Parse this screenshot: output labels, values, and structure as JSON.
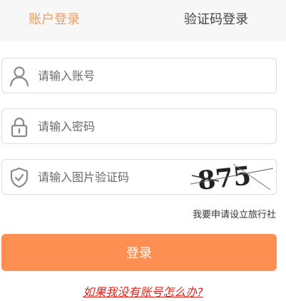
{
  "tabs": {
    "account_login": "账户登录",
    "code_login": "验证码登录"
  },
  "form": {
    "username_placeholder": "请输入账号",
    "password_placeholder": "请输入密码",
    "captcha_placeholder": "请输入图片验证码",
    "captcha_text": "875"
  },
  "links": {
    "apply_agency": "我要申请设立旅行社",
    "no_account_help": "如果我没有账号怎么办?"
  },
  "buttons": {
    "login": "登录"
  },
  "colors": {
    "accent_tab": "#f39a5e",
    "login_button": "#fe8f53",
    "help_link": "#e2241d"
  },
  "icons": [
    "user-icon",
    "lock-icon",
    "shield-check-icon"
  ]
}
